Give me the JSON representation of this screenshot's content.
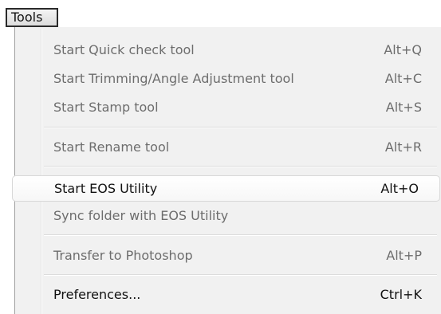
{
  "menubar": {
    "title": "Tools"
  },
  "menu": {
    "items": [
      {
        "label": "Start Quick check tool",
        "shortcut": "Alt+Q"
      },
      {
        "label": "Start Trimming/Angle Adjustment tool",
        "shortcut": "Alt+C"
      },
      {
        "label": "Start Stamp tool",
        "shortcut": "Alt+S"
      },
      {
        "label": "Start Rename tool",
        "shortcut": "Alt+R"
      },
      {
        "label": "Start EOS Utility",
        "shortcut": "Alt+O"
      },
      {
        "label": "Sync folder with EOS Utility",
        "shortcut": ""
      },
      {
        "label": "Transfer to Photoshop",
        "shortcut": "Alt+P"
      },
      {
        "label": "Preferences...",
        "shortcut": "Ctrl+K"
      }
    ]
  },
  "colors": {
    "disabled_text": "#6d6d6d",
    "enabled_text": "#111111",
    "menu_background": "#f1f1f1"
  }
}
